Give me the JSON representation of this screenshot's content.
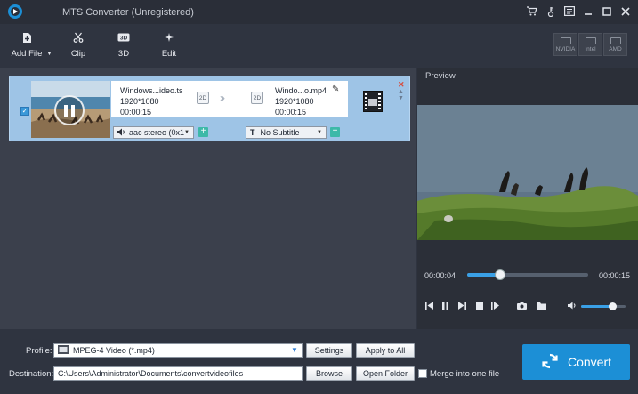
{
  "window": {
    "title": "MTS Converter (Unregistered)",
    "controls": [
      "cart-icon",
      "key-icon",
      "feedback-icon",
      "minimize-icon",
      "maximize-icon",
      "close-icon"
    ]
  },
  "toolbar": {
    "add_file": "Add File",
    "clip": "Clip",
    "three_d": "3D",
    "edit": "Edit",
    "accel": [
      "NVIDIA",
      "Intel",
      "AMD"
    ]
  },
  "file_item": {
    "checked": true,
    "source": {
      "name": "Windows...ideo.ts",
      "resolution": "1920*1080",
      "duration": "00:00:15",
      "dim": "2D"
    },
    "output": {
      "name": "Windo...o.mp4",
      "resolution": "1920*1080",
      "duration": "00:00:15",
      "dim": "2D"
    },
    "audio": "aac stereo (0x1",
    "subtitle": "No Subtitle",
    "subtitle_icon": "T"
  },
  "preview": {
    "label": "Preview",
    "current_time": "00:00:04",
    "total_time": "00:00:15",
    "progress_fraction": 0.27,
    "volume_fraction": 0.7
  },
  "bottom": {
    "profile_label": "Profile:",
    "profile_value": "MPEG-4 Video (*.mp4)",
    "settings": "Settings",
    "apply_all": "Apply to All",
    "destination_label": "Destination:",
    "destination_value": "C:\\Users\\Administrator\\Documents\\convertvideofiles",
    "browse": "Browse",
    "open_folder": "Open Folder",
    "merge_label": "Merge into one file",
    "merge_checked": false,
    "convert": "Convert"
  },
  "colors": {
    "accent": "#1c8fd6",
    "card": "#9ec4e6",
    "plus": "#3db9a8"
  }
}
